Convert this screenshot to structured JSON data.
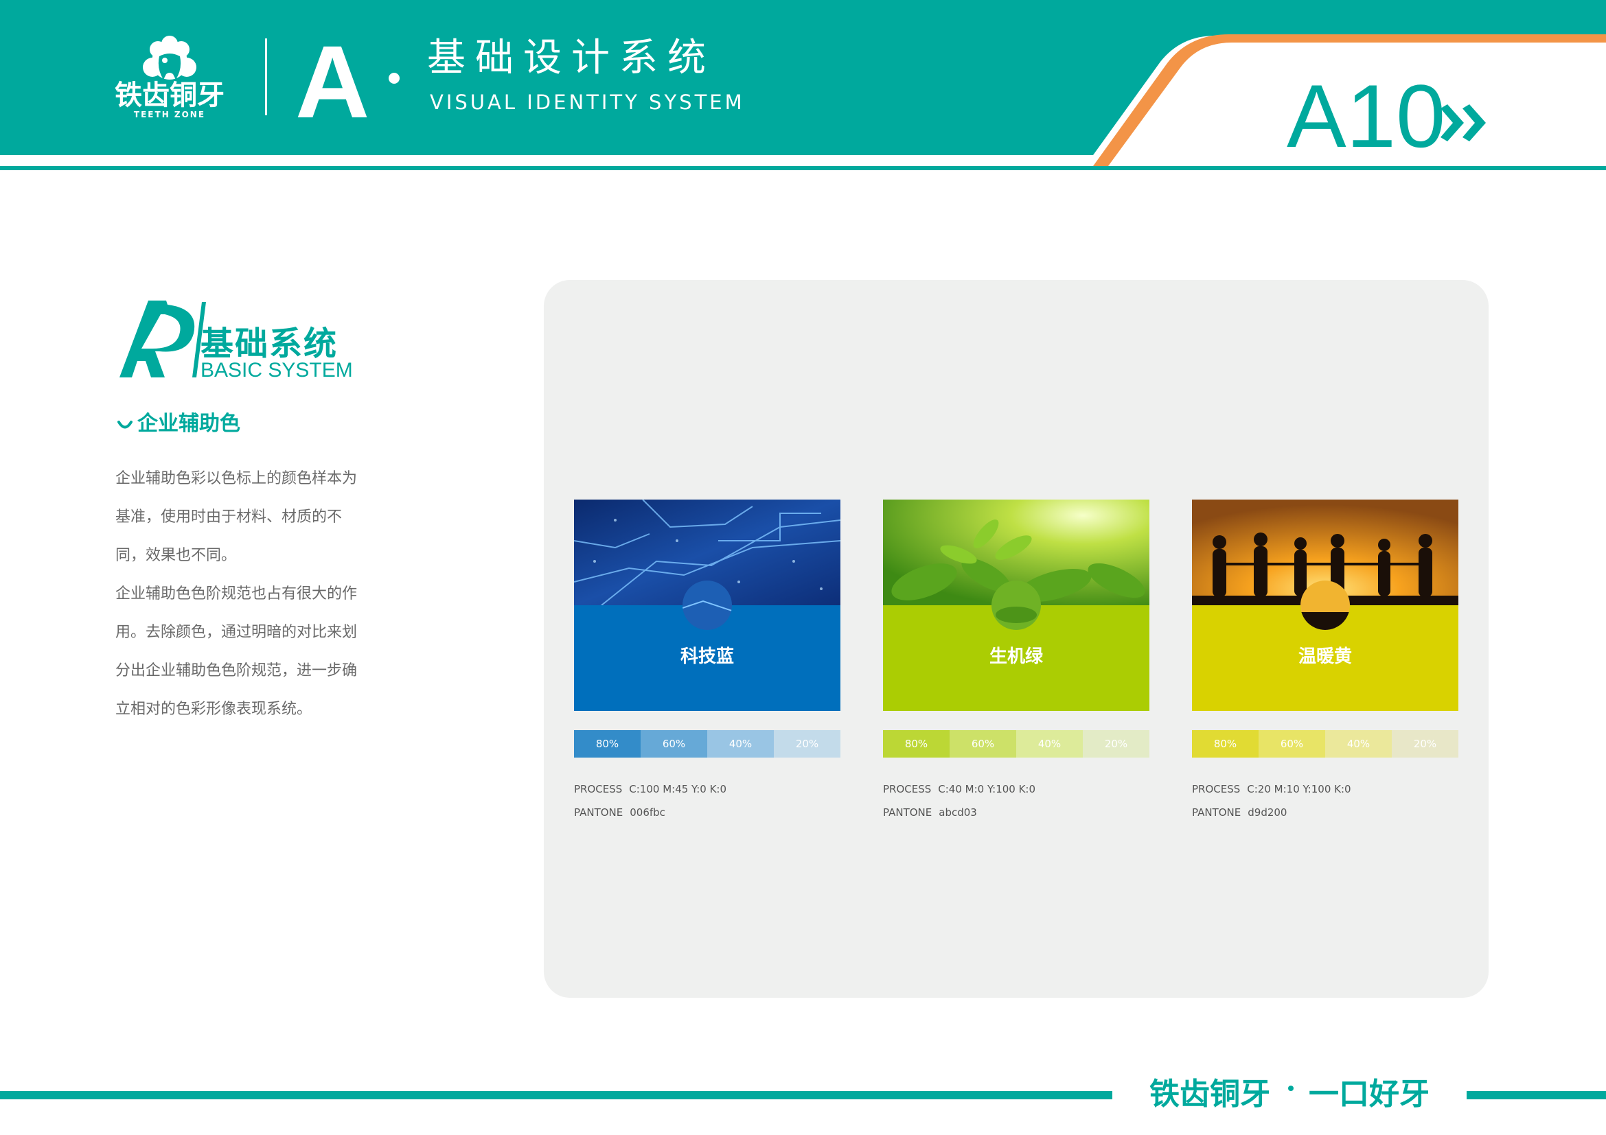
{
  "brand": {
    "name_cn": "铁齿铜牙",
    "name_en": "TEETH ZONE",
    "teal": "#00a99d",
    "orange": "#f39447"
  },
  "header": {
    "section_letter": "A",
    "title_cn": "基础设计系统",
    "title_en": "VISUAL IDENTITY SYSTEM",
    "page_code": "A10",
    "arrow_icon": "double-chevron-right-icon"
  },
  "section": {
    "title_cn": "基础系统",
    "title_en": "BASIC SYSTEM",
    "subtitle": "企业辅助色",
    "paragraph1": [
      "企业辅助色彩以色标上的颜色样本为",
      "基准，使用时由于材料、材质的不",
      "同，效果也不同。"
    ],
    "paragraph2": [
      "企业辅助色色阶规范也占有很大的作",
      "用。去除颜色，通过明暗的对比来划",
      "分出企业辅助色色阶规范，进一步确",
      "立相对的色彩形像表现系统。"
    ]
  },
  "swatches": [
    {
      "name": "科技蓝",
      "color": "#006fbc",
      "tint_colors": [
        "#338cc9",
        "#66a9d7",
        "#99c5e4",
        "#c3dbea"
      ],
      "tints": [
        "80%",
        "60%",
        "40%",
        "20%"
      ],
      "process_label": "PROCESS",
      "process": "C:100  M:45 Y:0   K:0",
      "pantone_label": "PANTONE",
      "pantone": "006fbc",
      "photo": "circuit-image"
    },
    {
      "name": "生机绿",
      "color": "#abcd03",
      "tint_colors": [
        "#bcd735",
        "#cde168",
        "#ddeb9a",
        "#e3ebc6"
      ],
      "tints": [
        "80%",
        "60%",
        "40%",
        "20%"
      ],
      "process_label": "PROCESS",
      "process": "C:40  M:0  Y:100  K:0",
      "pantone_label": "PANTONE",
      "pantone": "abcd03",
      "photo": "tea-leaves-image"
    },
    {
      "name": "温暖黄",
      "color": "#d9d200",
      "tint_colors": [
        "#e1db33",
        "#e8e466",
        "#ebe89b",
        "#e8e7c8"
      ],
      "tints": [
        "80%",
        "60%",
        "40%",
        "20%"
      ],
      "process_label": "PROCESS",
      "process": "C:20  M:10 Y:100  K:0",
      "pantone_label": "PANTONE",
      "pantone": "d9d200",
      "photo": "sunset-people-image"
    }
  ],
  "footer": {
    "slogan_a": "铁齿铜牙",
    "slogan_b": "一口好牙"
  }
}
